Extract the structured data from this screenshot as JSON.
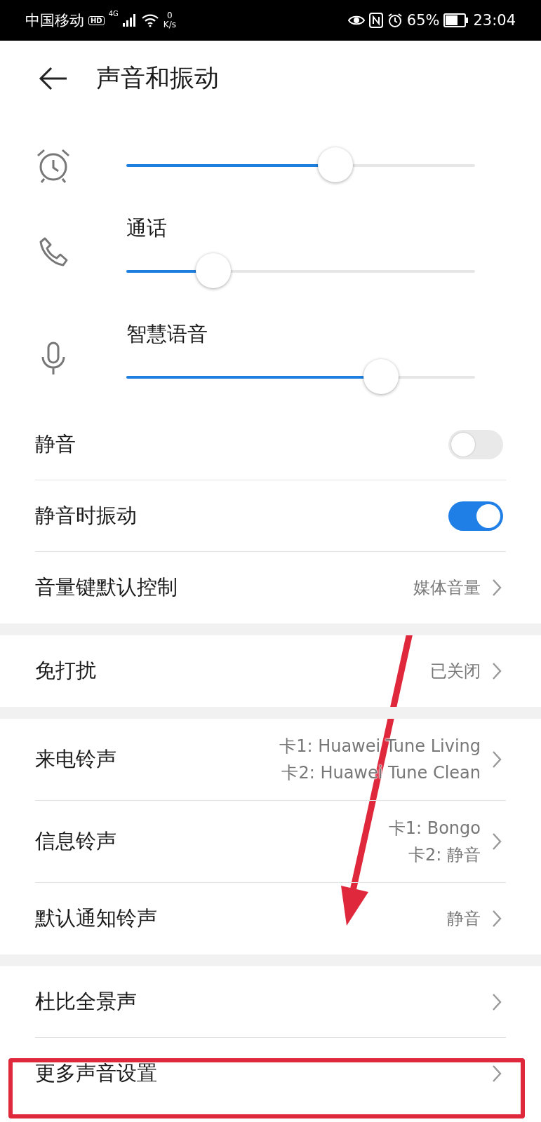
{
  "status_bar": {
    "carrier": "中国移动",
    "hd": "HD",
    "network": "4G",
    "speed_value": "0",
    "speed_unit": "K/s",
    "battery_text": "65%",
    "time": "23:04"
  },
  "header": {
    "title": "声音和振动"
  },
  "sliders": [
    {
      "kind": "alarm",
      "level": 0.6
    },
    {
      "kind": "phone",
      "label": "通话",
      "level": 0.25
    },
    {
      "kind": "mic",
      "label": "智慧语音",
      "level": 0.73
    }
  ],
  "sections": [
    {
      "items": [
        {
          "kind": "toggle",
          "label": "静音",
          "on": false
        },
        {
          "kind": "toggle",
          "label": "静音时振动",
          "on": true
        },
        {
          "kind": "link",
          "label": "音量键默认控制",
          "values": [
            "媒体音量"
          ]
        }
      ]
    },
    {
      "items": [
        {
          "kind": "link",
          "label": "免打扰",
          "values": [
            "已关闭"
          ]
        }
      ]
    },
    {
      "items": [
        {
          "kind": "link",
          "label": "来电铃声",
          "values": [
            "卡1: Huawei Tune Living",
            "卡2: Huawei Tune Clean"
          ]
        },
        {
          "kind": "link",
          "label": "信息铃声",
          "values": [
            "卡1: Bongo",
            "卡2: 静音"
          ]
        },
        {
          "kind": "link",
          "label": "默认通知铃声",
          "values": [
            "静音"
          ]
        }
      ]
    },
    {
      "items": [
        {
          "kind": "link",
          "label": "杜比全景声"
        },
        {
          "kind": "link",
          "label": "更多声音设置"
        }
      ]
    }
  ]
}
